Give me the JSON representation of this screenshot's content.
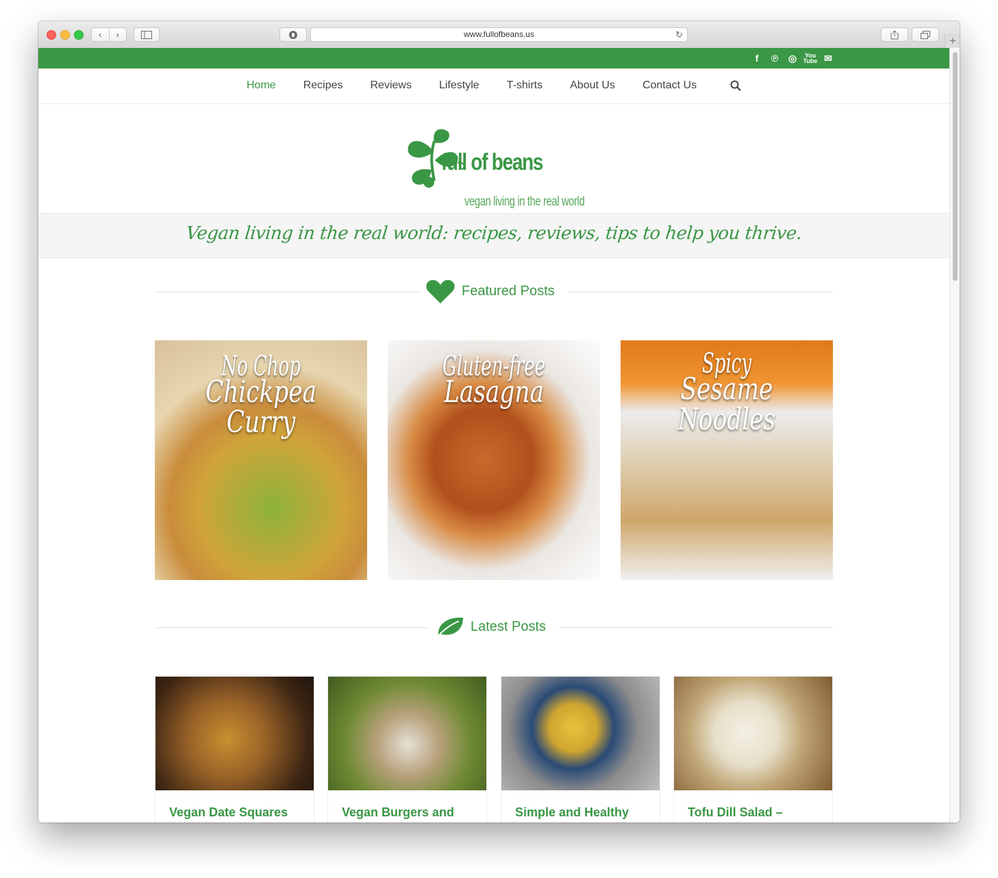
{
  "browser": {
    "url": "www.fullofbeans.us",
    "back_glyph": "‹",
    "forward_glyph": "›",
    "new_tab_glyph": "+"
  },
  "social": {
    "icons": [
      "facebook-icon",
      "pinterest-icon",
      "instagram-icon",
      "youtube-icon",
      "email-icon"
    ],
    "facebook_glyph": "f",
    "pinterest_glyph": "℗",
    "instagram_glyph": "◎",
    "youtube_glyph": "You Tube",
    "email_glyph": "✉"
  },
  "nav": {
    "items": [
      {
        "label": "Home",
        "active": true
      },
      {
        "label": "Recipes"
      },
      {
        "label": "Reviews"
      },
      {
        "label": "Lifestyle"
      },
      {
        "label": "T-shirts"
      },
      {
        "label": "About Us"
      },
      {
        "label": "Contact Us"
      }
    ]
  },
  "logo": {
    "title": "full of beans",
    "subtitle": "vegan living in the real world"
  },
  "tagline": "Vegan living in the real world: recipes, reviews, tips to help you thrive.",
  "featured": {
    "heading": "Featured Posts",
    "posts": [
      {
        "line1": "No Chop",
        "line2": "Chickpea Curry"
      },
      {
        "line1": "Gluten-free",
        "line2": "Lasagna"
      },
      {
        "line1": "Spicy",
        "line2": "Sesame Noodles"
      }
    ]
  },
  "latest": {
    "heading": "Latest Posts",
    "posts": [
      {
        "title": "Vegan Date Squares"
      },
      {
        "title": "Vegan Burgers and"
      },
      {
        "title": "Simple and Healthy"
      },
      {
        "title": "Tofu Dill Salad –"
      }
    ]
  },
  "colors": {
    "brand_green": "#3a9745"
  }
}
